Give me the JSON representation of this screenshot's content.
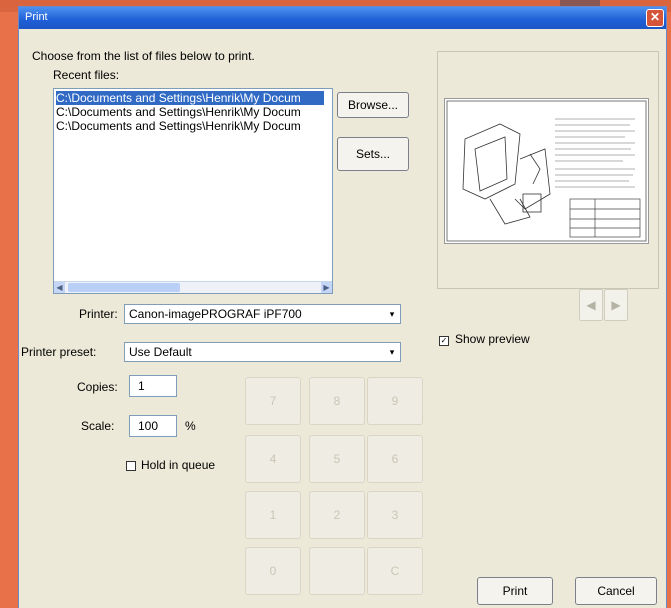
{
  "window": {
    "title": "Print",
    "close_glyph": "✕"
  },
  "intro_text": "Choose from the list of files below to print.",
  "recent_files": {
    "label": "Recent files:",
    "items": [
      "C:\\Documents and Settings\\Henrik\\My Docum",
      "C:\\Documents and Settings\\Henrik\\My Docum",
      "C:\\Documents and Settings\\Henrik\\My Docum"
    ],
    "selected_index": 0
  },
  "buttons": {
    "browse": "Browse...",
    "sets": "Sets...",
    "print": "Print",
    "cancel": "Cancel"
  },
  "printer": {
    "label": "Printer:",
    "value": "Canon-imagePROGRAF iPF700"
  },
  "preset": {
    "label": "Printer preset:",
    "value": "Use Default"
  },
  "copies": {
    "label": "Copies:",
    "value": "1"
  },
  "scale": {
    "label": "Scale:",
    "value": "100",
    "unit": "%"
  },
  "hold_in_queue": {
    "label": "Hold in queue",
    "checked": false
  },
  "show_preview": {
    "label": "Show preview",
    "checked": true,
    "check_glyph": "✓"
  },
  "keypad": [
    "7",
    "8",
    "9",
    "4",
    "5",
    "6",
    "1",
    "2",
    "3",
    "0",
    "",
    "C"
  ],
  "preview_nav": {
    "prev": "◀",
    "next": "▶"
  },
  "dropdown_glyph": "▾",
  "scroll_glyphs": {
    "left": "◀",
    "right": "▶"
  },
  "colors": {
    "accent": "#316ac5",
    "titlebar": "#1e5fd6",
    "background": "#e9714a",
    "dialog": "#ece9d8"
  }
}
